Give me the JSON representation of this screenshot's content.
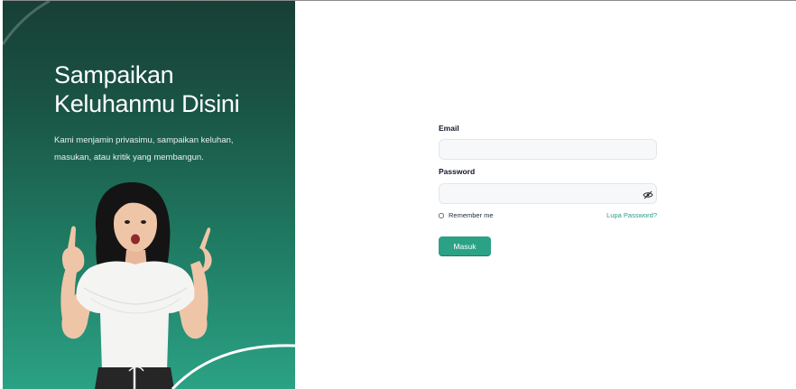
{
  "hero": {
    "title_line1": "Sampaikan",
    "title_line2": "Keluhanmu Disini",
    "subtitle_line1": "Kami menjamin privasimu, sampaikan keluhan,",
    "subtitle_line2": "masukan, atau kritik yang membangun."
  },
  "form": {
    "email_label": "Email",
    "email_value": "",
    "password_label": "Password",
    "password_value": "",
    "remember_label": "Remember me",
    "remember_checked": false,
    "forgot_label": "Lupa Password?",
    "submit_label": "Masuk"
  },
  "colors": {
    "accent": "#2ba285",
    "hero_dark": "#173f36",
    "hero_light": "#2ba285"
  },
  "icons": {
    "password_toggle": "eye-slash-icon"
  }
}
